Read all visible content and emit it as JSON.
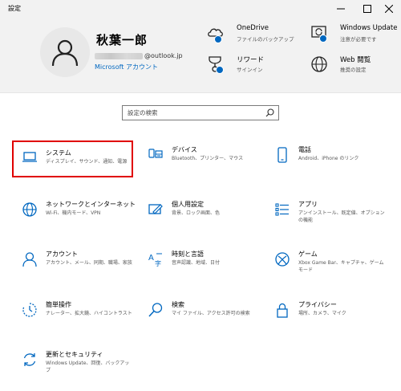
{
  "window": {
    "title": "設定"
  },
  "user": {
    "name": "秋葉一郎",
    "email": "@outlook.jp",
    "account_link": "Microsoft アカウント"
  },
  "quick_links": [
    {
      "id": "onedrive",
      "title": "OneDrive",
      "subtitle": "ファイルのバックアップ",
      "icon": "onedrive-icon"
    },
    {
      "id": "windows-update",
      "title": "Windows Update",
      "subtitle": "注意が必要です",
      "icon": "windows-update-icon"
    },
    {
      "id": "rewards",
      "title": "リワード",
      "subtitle": "サインイン",
      "icon": "rewards-icon"
    },
    {
      "id": "web-browsing",
      "title": "Web 閲覧",
      "subtitle": "推奨の設定",
      "icon": "globe-icon"
    }
  ],
  "search": {
    "placeholder": "設定の検索"
  },
  "categories": [
    {
      "name": "システム",
      "desc": "ディスプレイ、サウンド、通知、電源",
      "icon": "laptop-icon"
    },
    {
      "name": "デバイス",
      "desc": "Bluetooth、プリンター、マウス",
      "icon": "devices-icon"
    },
    {
      "name": "電話",
      "desc": "Android、iPhone のリンク",
      "icon": "phone-icon"
    },
    {
      "name": "ネットワークとインターネット",
      "desc": "Wi-Fi、機内モード、VPN",
      "icon": "globe-icon"
    },
    {
      "name": "個人用設定",
      "desc": "背景、ロック画面、色",
      "icon": "personalization-icon"
    },
    {
      "name": "アプリ",
      "desc": "アンインストール、既定値、オプションの機能",
      "icon": "apps-list-icon"
    },
    {
      "name": "アカウント",
      "desc": "アカウント、メール、同期、職場、家族",
      "icon": "person-icon"
    },
    {
      "name": "時刻と言語",
      "desc": "音声認識、地域、日付",
      "icon": "time-language-icon"
    },
    {
      "name": "ゲーム",
      "desc": "Xbox Game Bar、キャプチャ、ゲーム モード",
      "icon": "xbox-icon"
    },
    {
      "name": "簡単操作",
      "desc": "ナレーター、拡大鏡、ハイコントラスト",
      "icon": "ease-of-access-icon"
    },
    {
      "name": "検索",
      "desc": "マイ ファイル、アクセス許可の検索",
      "icon": "search-icon"
    },
    {
      "name": "プライバシー",
      "desc": "場所、カメラ、マイク",
      "icon": "lock-icon"
    },
    {
      "name": "更新とセキュリティ",
      "desc": "Windows Update、回復、バックアップ",
      "icon": "sync-icon"
    }
  ],
  "selected_category": "システム",
  "colors": {
    "accent": "#0067c0",
    "selection_border": "#e00000",
    "header_bg": "#f2f2f2"
  }
}
